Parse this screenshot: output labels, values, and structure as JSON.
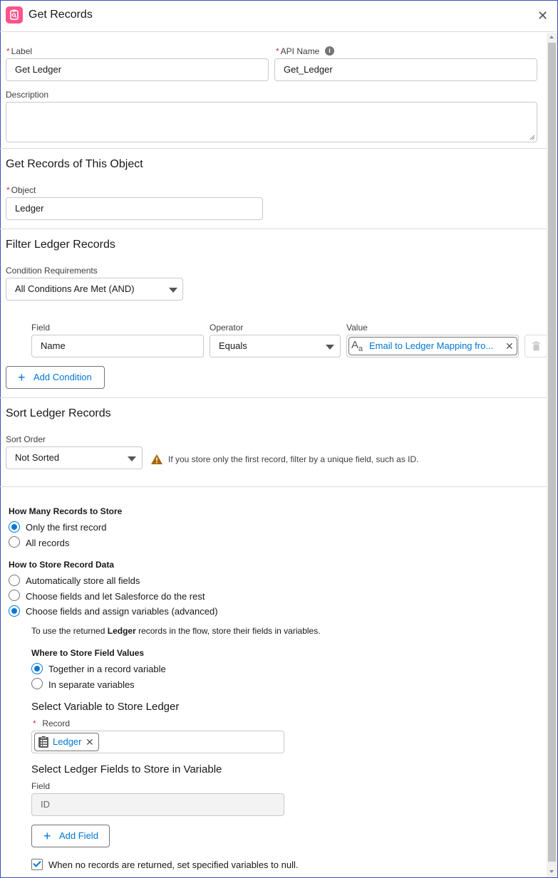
{
  "header": {
    "title": "Get Records"
  },
  "label_field": {
    "label": "Label",
    "value": "Get Ledger"
  },
  "api_field": {
    "label": "API Name",
    "value": "Get_Ledger"
  },
  "description": {
    "label": "Description",
    "value": ""
  },
  "object_section": {
    "title": "Get Records of This Object",
    "object_label": "Object",
    "object_value": "Ledger"
  },
  "filter_section": {
    "title": "Filter Ledger Records",
    "condition_label": "Condition Requirements",
    "condition_value": "All Conditions Are Met (AND)",
    "field_header": "Field",
    "operator_header": "Operator",
    "value_header": "Value",
    "row": {
      "field": "Name",
      "operator": "Equals",
      "value": "Email to Ledger Mapping fro..."
    },
    "add_condition": "Add Condition"
  },
  "sort_section": {
    "title": "Sort Ledger Records",
    "order_label": "Sort Order",
    "order_value": "Not Sorted",
    "warning": "If you store only the first record, filter by a unique field, such as ID."
  },
  "store_section": {
    "how_many_label": "How Many Records to Store",
    "how_many_options": [
      "Only the first record",
      "All records"
    ],
    "how_many_selected": 0,
    "how_store_label": "How to Store Record Data",
    "how_store_options": [
      "Automatically store all fields",
      "Choose fields and let Salesforce do the rest",
      "Choose fields and assign variables (advanced)"
    ],
    "how_store_selected": 2,
    "info_prefix": "To use the returned ",
    "info_bold": "Ledger",
    "info_suffix": " records in the flow, store their fields in variables.",
    "where_label": "Where to Store Field Values",
    "where_options": [
      "Together in a record variable",
      "In separate variables"
    ],
    "where_selected": 0,
    "select_var_title": "Select Variable to Store Ledger",
    "record_label": "Record",
    "record_pill": "Ledger",
    "select_fields_title": "Select Ledger Fields to Store in Variable",
    "field_label": "Field",
    "field_value": "ID",
    "add_field": "Add Field",
    "null_checkbox_label": "When no records are returned, set specified variables to null.",
    "null_checked": true
  },
  "colors": {
    "accent": "#0176d3",
    "required": "#c23934",
    "icon_pink": "#ff538a",
    "warning": "#a96404"
  }
}
